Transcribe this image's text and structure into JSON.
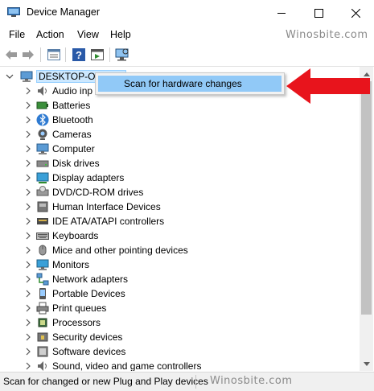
{
  "window": {
    "title": "Device Manager"
  },
  "menu": [
    "File",
    "Action",
    "View",
    "Help"
  ],
  "watermark_top": "Winosbite.com",
  "watermark_status": "Winosbite.com",
  "tree": {
    "root": "DESKTOP-OD",
    "items": [
      {
        "label": "Audio inp",
        "icon": "speaker-icon"
      },
      {
        "label": "Batteries",
        "icon": "battery-icon"
      },
      {
        "label": "Bluetooth",
        "icon": "bluetooth-icon"
      },
      {
        "label": "Cameras",
        "icon": "camera-icon"
      },
      {
        "label": "Computer",
        "icon": "computer-icon"
      },
      {
        "label": "Disk drives",
        "icon": "disk-drive-icon"
      },
      {
        "label": "Display adapters",
        "icon": "display-adapter-icon"
      },
      {
        "label": "DVD/CD-ROM drives",
        "icon": "dvd-icon"
      },
      {
        "label": "Human Interface Devices",
        "icon": "hid-icon"
      },
      {
        "label": "IDE ATA/ATAPI controllers",
        "icon": "ide-controller-icon"
      },
      {
        "label": "Keyboards",
        "icon": "keyboard-icon"
      },
      {
        "label": "Mice and other pointing devices",
        "icon": "mouse-icon"
      },
      {
        "label": "Monitors",
        "icon": "monitor-icon"
      },
      {
        "label": "Network adapters",
        "icon": "network-icon"
      },
      {
        "label": "Portable Devices",
        "icon": "portable-device-icon"
      },
      {
        "label": "Print queues",
        "icon": "printer-icon"
      },
      {
        "label": "Processors",
        "icon": "processor-icon"
      },
      {
        "label": "Security devices",
        "icon": "security-device-icon"
      },
      {
        "label": "Software devices",
        "icon": "software-device-icon"
      },
      {
        "label": "Sound, video and game controllers",
        "icon": "sound-icon"
      }
    ]
  },
  "context_menu": {
    "item": "Scan for hardware changes"
  },
  "status": {
    "text": "Scan for changed or new Plug and Play devices"
  },
  "colors": {
    "arrow": "#e8141c",
    "selection": "#cce8ff",
    "menu_highlight": "#91c9f7"
  }
}
